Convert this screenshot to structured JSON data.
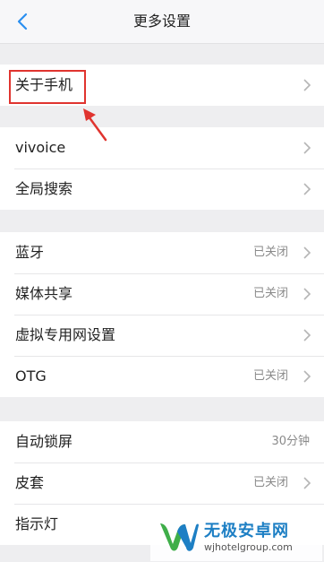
{
  "header": {
    "title": "更多设置",
    "back_icon": "back-chevron-icon",
    "accent_color": "#2a8ff0"
  },
  "groups": [
    {
      "items": [
        {
          "label": "关于手机",
          "value": "",
          "icon": "chevron-right-icon"
        }
      ]
    },
    {
      "items": [
        {
          "label": "vivoice",
          "value": "",
          "icon": "chevron-right-icon"
        },
        {
          "label": "全局搜索",
          "value": "",
          "icon": "chevron-right-icon"
        }
      ]
    },
    {
      "items": [
        {
          "label": "蓝牙",
          "value": "已关闭",
          "icon": "chevron-right-icon"
        },
        {
          "label": "媒体共享",
          "value": "已关闭",
          "icon": "chevron-right-icon"
        },
        {
          "label": "虚拟专用网设置",
          "value": "",
          "icon": "chevron-right-icon"
        },
        {
          "label": "OTG",
          "value": "已关闭",
          "icon": "chevron-right-icon"
        }
      ]
    },
    {
      "items": [
        {
          "label": "自动锁屏",
          "value": "30分钟",
          "icon": ""
        },
        {
          "label": "皮套",
          "value": "已关闭",
          "icon": "chevron-right-icon"
        },
        {
          "label": "指示灯",
          "value": "",
          "icon": ""
        }
      ]
    }
  ],
  "annotation": {
    "highlight_color": "#e0342f",
    "arrow_icon": "annotation-arrow-icon"
  },
  "watermark": {
    "name": "无极安卓网",
    "url": "wjhotelgroup.com",
    "logo_icon": "w-logo-icon",
    "brand_color": "#1d7fc4"
  }
}
